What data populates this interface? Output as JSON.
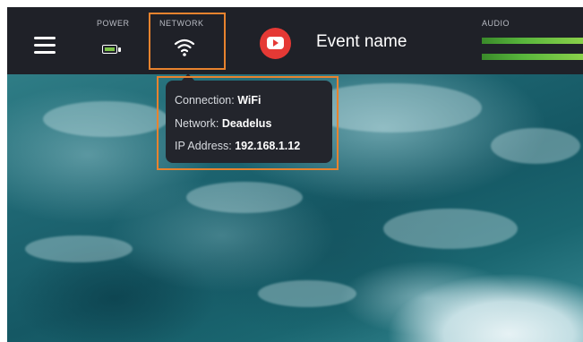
{
  "topbar": {
    "power_label": "POWER",
    "network_label": "NETWORK",
    "audio_label": "AUDIO",
    "event_name": "Event name",
    "icons": {
      "menu": "hamburger-menu-icon",
      "power": "battery-icon",
      "network": "wifi-icon",
      "stream": "youtube-icon"
    },
    "audio_levels": {
      "left": 1.0,
      "right": 1.0
    }
  },
  "network_tooltip": {
    "connection_label": "Connection:",
    "connection_value": "WiFi",
    "network_label": "Network:",
    "network_value": "Deadelus",
    "ip_label": "IP Address:",
    "ip_value": "192.168.1.12"
  },
  "colors": {
    "topbar_bg": "#1f2128",
    "highlight_outline": "#e8832e",
    "youtube_red": "#e53935",
    "audio_green": "#58b53c",
    "tooltip_bg": "#23252c"
  }
}
